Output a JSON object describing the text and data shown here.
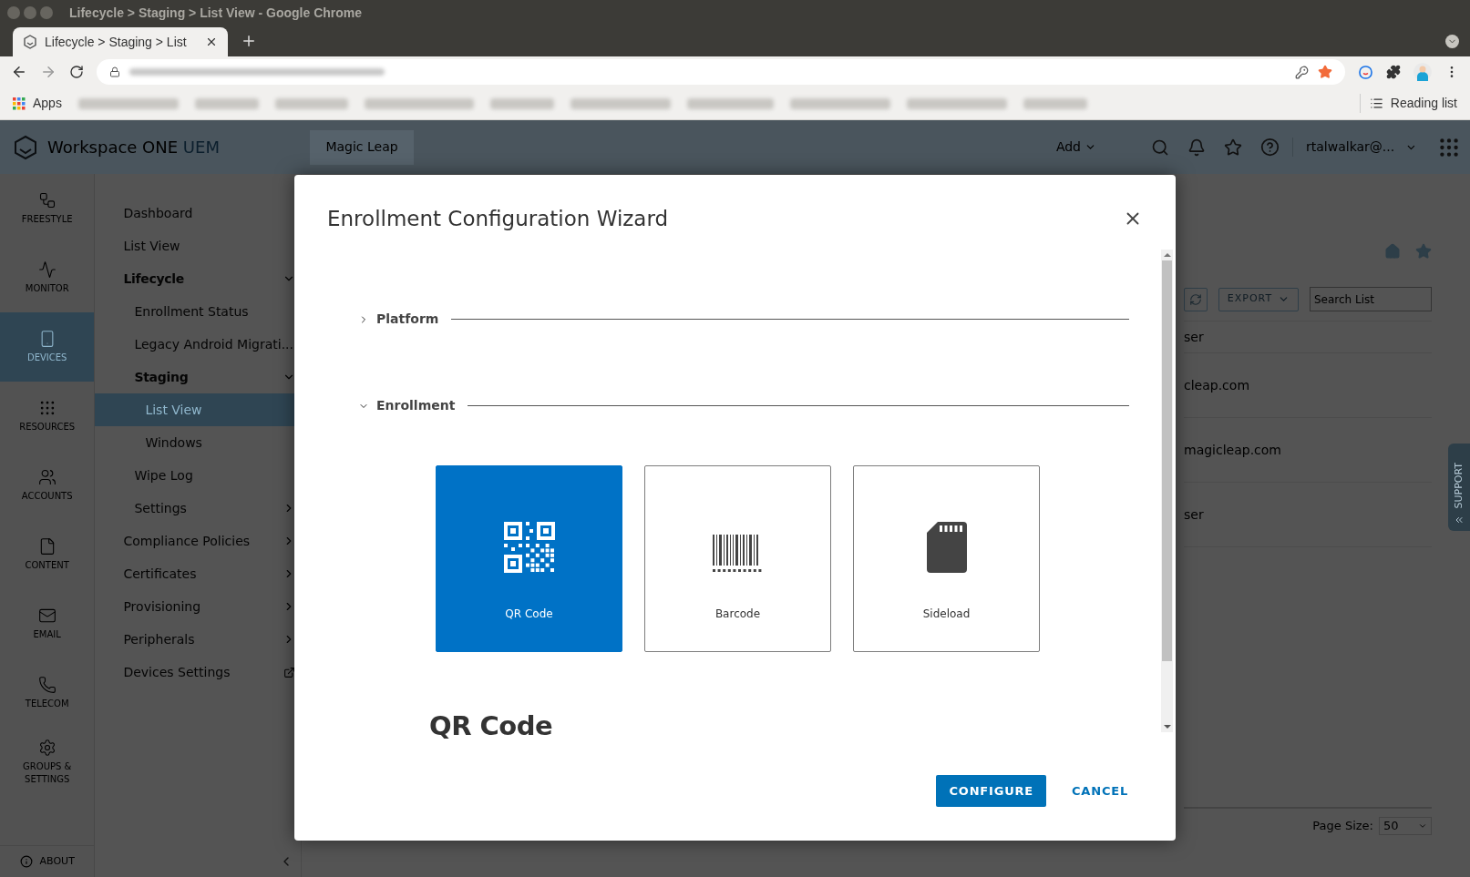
{
  "browser": {
    "window_title": "Lifecycle > Staging > List View - Google Chrome",
    "tab_title": "Lifecycle > Staging > List",
    "bookmarks_apps": "Apps",
    "reading_list": "Reading list"
  },
  "app_header": {
    "brand": "Workspace ONE",
    "brand_suffix": "UEM",
    "org_tab": "Magic Leap",
    "add_menu": "Add",
    "user_menu": "rtalwalkar@..."
  },
  "rail": [
    {
      "label": "FREESTYLE",
      "kind": "freestyle",
      "selected": false
    },
    {
      "label": "MONITOR",
      "kind": "monitor",
      "selected": false
    },
    {
      "label": "DEVICES",
      "kind": "devices",
      "selected": true
    },
    {
      "label": "RESOURCES",
      "kind": "resources",
      "selected": false
    },
    {
      "label": "ACCOUNTS",
      "kind": "accounts",
      "selected": false
    },
    {
      "label": "CONTENT",
      "kind": "content",
      "selected": false
    },
    {
      "label": "EMAIL",
      "kind": "email",
      "selected": false
    },
    {
      "label": "TELECOM",
      "kind": "telecom",
      "selected": false
    },
    {
      "label": "GROUPS & SETTINGS",
      "kind": "settings",
      "selected": false
    }
  ],
  "rail_footer": "ABOUT",
  "nav": {
    "items": [
      {
        "label": "Dashboard",
        "kind": "link",
        "selected": false
      },
      {
        "label": "List View",
        "kind": "link",
        "selected": false
      },
      {
        "label": "Lifecycle",
        "kind": "group",
        "expanded": true,
        "children": [
          {
            "label": "Enrollment Status",
            "kind": "link",
            "selected": false
          },
          {
            "label": "Legacy Android Migrati...",
            "kind": "link",
            "selected": false
          },
          {
            "label": "Staging",
            "kind": "group",
            "expanded": true,
            "children": [
              {
                "label": "List View",
                "kind": "link",
                "selected": true
              },
              {
                "label": "Windows",
                "kind": "link",
                "selected": false
              }
            ]
          },
          {
            "label": "Wipe Log",
            "kind": "link",
            "selected": false
          },
          {
            "label": "Settings",
            "kind": "submenu",
            "selected": false
          }
        ]
      },
      {
        "label": "Compliance Policies",
        "kind": "submenu",
        "selected": false
      },
      {
        "label": "Certificates",
        "kind": "submenu",
        "selected": false
      },
      {
        "label": "Provisioning",
        "kind": "submenu",
        "selected": false
      },
      {
        "label": "Peripherals",
        "kind": "submenu",
        "selected": false
      },
      {
        "label": "Devices Settings",
        "kind": "external",
        "selected": false
      }
    ]
  },
  "list_page": {
    "export_button": "EXPORT",
    "search": {
      "placeholder": "Search List"
    },
    "column_header": "ser",
    "rows": [
      "cleap.com",
      "magicleap.com",
      "ser"
    ],
    "page_size_label": "Page Size:",
    "page_size": "50",
    "support_tab": "SUPPORT"
  },
  "dialog": {
    "title": "Enrollment Configuration Wizard",
    "sections": [
      {
        "label": "Platform",
        "expanded": false
      },
      {
        "label": "Enrollment",
        "expanded": true
      }
    ],
    "options": [
      {
        "label": "QR Code",
        "kind": "qr",
        "selected": true
      },
      {
        "label": "Barcode",
        "kind": "barcode",
        "selected": false
      },
      {
        "label": "Sideload",
        "kind": "sideload",
        "selected": false
      }
    ],
    "detail_heading": "QR Code",
    "buttons": [
      {
        "label": "CONFIGURE",
        "kind": "primary"
      },
      {
        "label": "CANCEL",
        "kind": "link"
      }
    ]
  }
}
